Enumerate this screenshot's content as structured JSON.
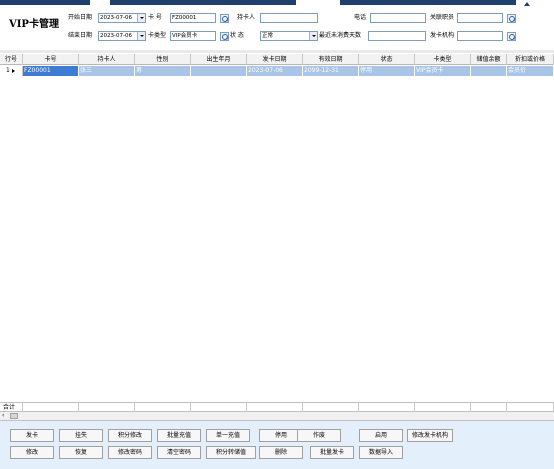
{
  "header": {
    "title": "VIP卡管理"
  },
  "filters": {
    "start_date_label": "开始日期",
    "start_date": "2023-07-06",
    "end_date_label": "结束日期",
    "end_date": "2023-07-06",
    "card_no_label": "卡 号",
    "card_no": "FZ00001",
    "card_type_label": "卡类型",
    "card_type": "VIP会员卡",
    "holder_label": "持卡人",
    "holder": "",
    "status_label": "状 态",
    "status": "正常",
    "days_label": "最近未消费天数",
    "days": "",
    "phone_label": "电话",
    "phone": "",
    "staff_label": "关联职员",
    "staff": "",
    "issuer_label": "发卡机构",
    "issuer": ""
  },
  "grid": {
    "columns": [
      "行号",
      "卡号",
      "持卡人",
      "性别",
      "出生年月",
      "发卡日期",
      "有效日期",
      "状态",
      "卡类型",
      "储值余额",
      "折扣或价格"
    ],
    "rows": [
      {
        "row_no": "1",
        "card_no": "FZ00001",
        "holder": "张三",
        "gender": "男",
        "birth": "",
        "issue_date": "2023-07-06",
        "valid_date": "2099-12-31",
        "status": "停用",
        "card_type": "VIP会员卡",
        "balance": "",
        "discount": "会员价"
      }
    ],
    "total_label": "合计"
  },
  "buttons": {
    "row1": [
      "发卡",
      "挂失",
      "积分修改",
      "批量充值",
      "单一充值",
      "停用",
      "作废",
      "启用",
      "修改发卡机构"
    ],
    "row2": [
      "修改",
      "恢复",
      "修改密码",
      "清空密码",
      "积分转储值",
      "删除",
      "批量发卡",
      "数据导入"
    ]
  }
}
